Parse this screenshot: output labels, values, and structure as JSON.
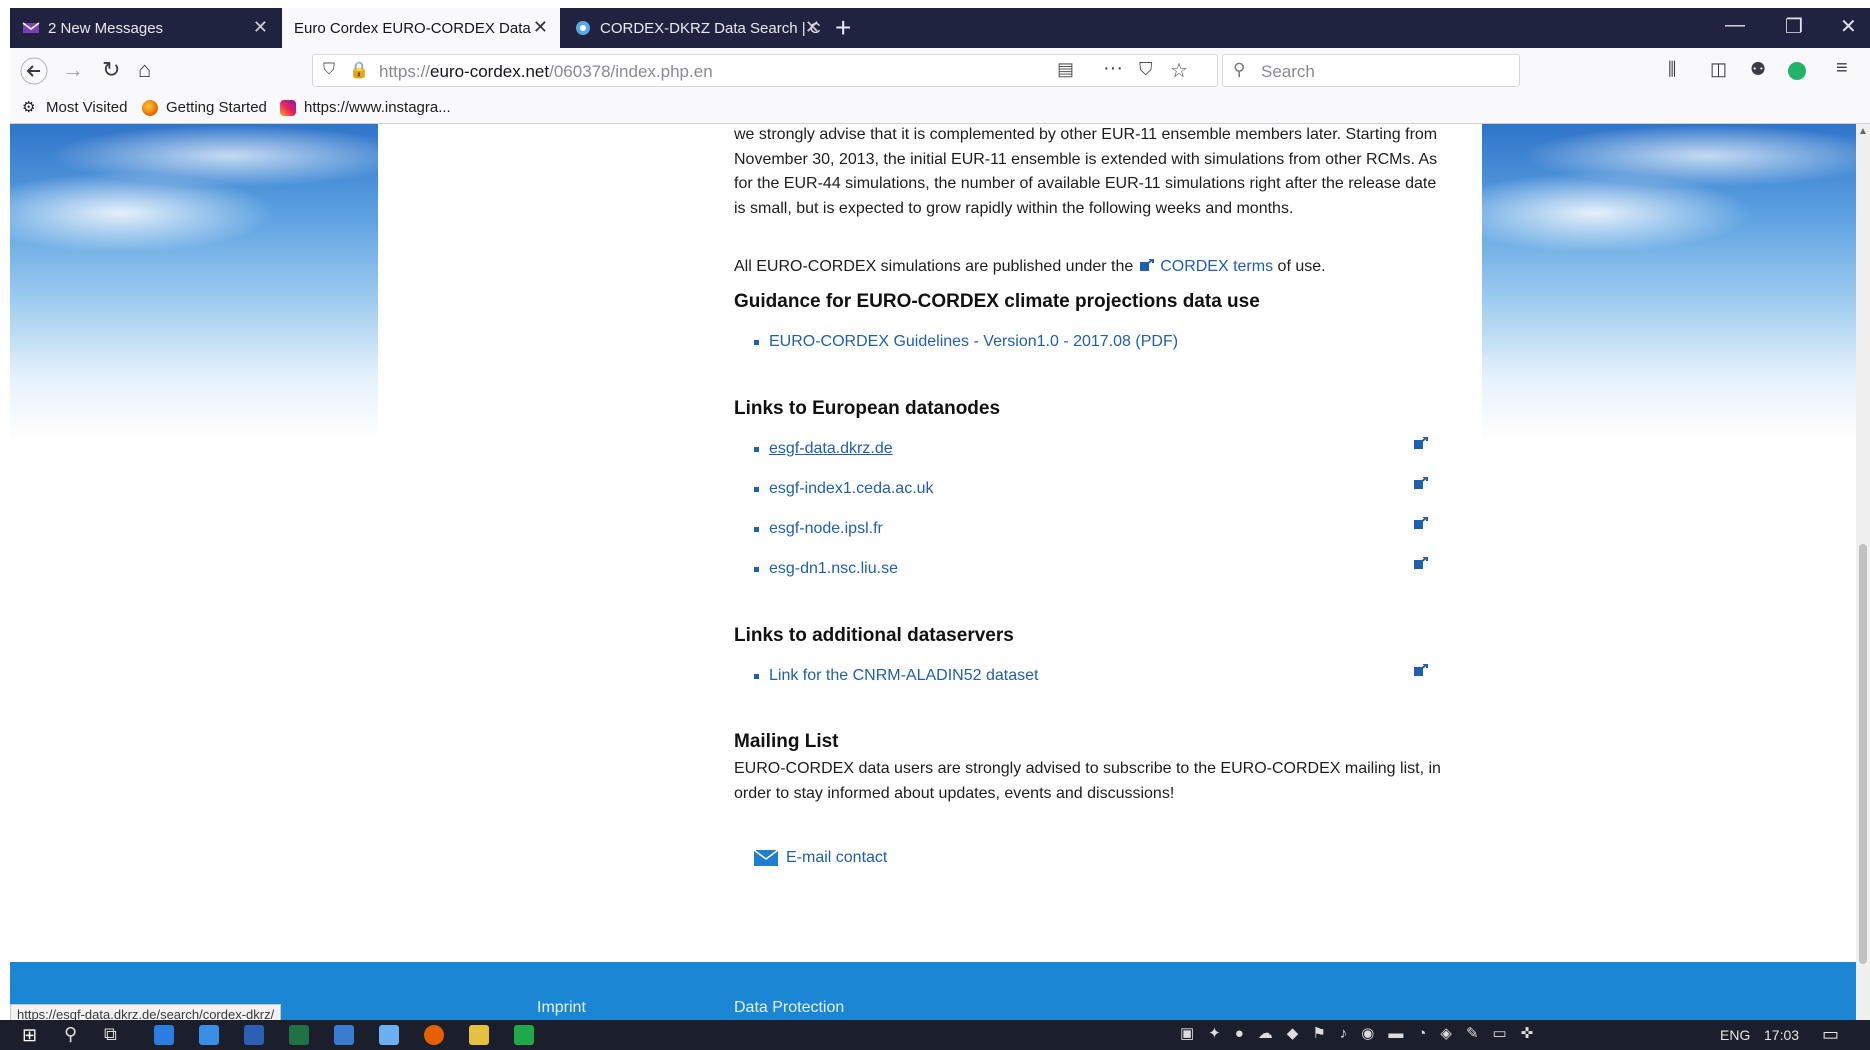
{
  "tabs": [
    {
      "title": "2 New Messages",
      "active": false
    },
    {
      "title": "Euro Cordex EURO-CORDEX Data",
      "active": true
    },
    {
      "title": "CORDEX-DKRZ Data Search | C",
      "active": false
    }
  ],
  "nav": {
    "url_prefix": "https://",
    "url_host": "euro-cordex.net",
    "url_path": "/060378/index.php.en",
    "search_placeholder": "Search"
  },
  "bookmarks": [
    {
      "label": "Most Visited",
      "icon": "gear-icon"
    },
    {
      "label": "Getting Started",
      "icon": "firefox-icon"
    },
    {
      "label": "https://www.instagra...",
      "icon": "instagram-icon"
    }
  ],
  "content": {
    "intro": "we strongly advise that it is complemented by other EUR-11 ensemble members later. Starting from November 30, 2013, the initial EUR-11 ensemble is extended with simulations from other RCMs. As for the EUR-44 simulations, the number of available EUR-11 simulations right after the release date is small, but is expected to grow rapidly within the following weeks and months.",
    "terms_pre": "All EURO-CORDEX simulations are published under the",
    "terms_link": "CORDEX terms",
    "terms_post": "of use.",
    "guidance_heading": "Guidance for EURO-CORDEX climate projections data use",
    "guidance_link": "EURO-CORDEX Guidelines - Version1.0 - 2017.08 (PDF)",
    "datanodes_heading": "Links to European datanodes",
    "datanodes": [
      "esgf-data.dkrz.de",
      "esgf-index1.ceda.ac.uk",
      "esgf-node.ipsl.fr",
      "esg-dn1.nsc.liu.se"
    ],
    "dataservers_heading": "Links to additional dataservers",
    "dataservers": [
      "Link for the CNRM-ALADIN52 dataset"
    ],
    "mailing_heading": "Mailing List",
    "mailing_text": "EURO-CORDEX data users are strongly advised to subscribe to the EURO-CORDEX mailing list, in order to stay informed about updates, events and discussions!",
    "email_link": "E-mail contact"
  },
  "footer": {
    "imprint": "Imprint",
    "data_protection": "Data Protection"
  },
  "status_url": "https://esgf-data.dkrz.de/search/cordex-dkrz/",
  "taskbar": {
    "lang": "ENG",
    "time": "17:03"
  }
}
